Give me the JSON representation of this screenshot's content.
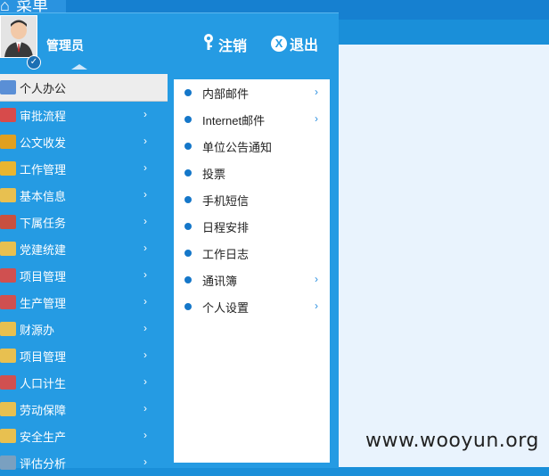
{
  "topbar": {
    "menu_label": "菜单"
  },
  "header": {
    "user_name": "管理员",
    "logoff_label": "注销",
    "logout_label": "退出"
  },
  "left_menu": [
    {
      "label": "个人办公",
      "icon_color": "#5a8fd6",
      "active": true
    },
    {
      "label": "审批流程",
      "icon_color": "#d74b4b"
    },
    {
      "label": "公文收发",
      "icon_color": "#e0a020"
    },
    {
      "label": "工作管理",
      "icon_color": "#e8b530"
    },
    {
      "label": "基本信息",
      "icon_color": "#e8c050"
    },
    {
      "label": "下属任务",
      "icon_color": "#c95040"
    },
    {
      "label": "党建统建",
      "icon_color": "#e8c050"
    },
    {
      "label": "项目管理",
      "icon_color": "#d05050"
    },
    {
      "label": "生产管理",
      "icon_color": "#d05050"
    },
    {
      "label": "财源办",
      "icon_color": "#e8c050"
    },
    {
      "label": "项目管理",
      "icon_color": "#e8c050"
    },
    {
      "label": "人口计生",
      "icon_color": "#d05050"
    },
    {
      "label": "劳动保障",
      "icon_color": "#e8c050"
    },
    {
      "label": "安全生产",
      "icon_color": "#e8c050"
    },
    {
      "label": "评估分析",
      "icon_color": "#7aa0c0"
    }
  ],
  "sub_menu": [
    {
      "label": "内部邮件",
      "arrow": true
    },
    {
      "label": "Internet邮件",
      "arrow": true
    },
    {
      "label": "单位公告通知",
      "arrow": false
    },
    {
      "label": "投票",
      "arrow": false
    },
    {
      "label": "手机短信",
      "arrow": false
    },
    {
      "label": "日程安排",
      "arrow": false
    },
    {
      "label": "工作日志",
      "arrow": false
    },
    {
      "label": "通讯簿",
      "arrow": true
    },
    {
      "label": "个人设置",
      "arrow": true
    }
  ],
  "watermark": "www.wooyun.org"
}
